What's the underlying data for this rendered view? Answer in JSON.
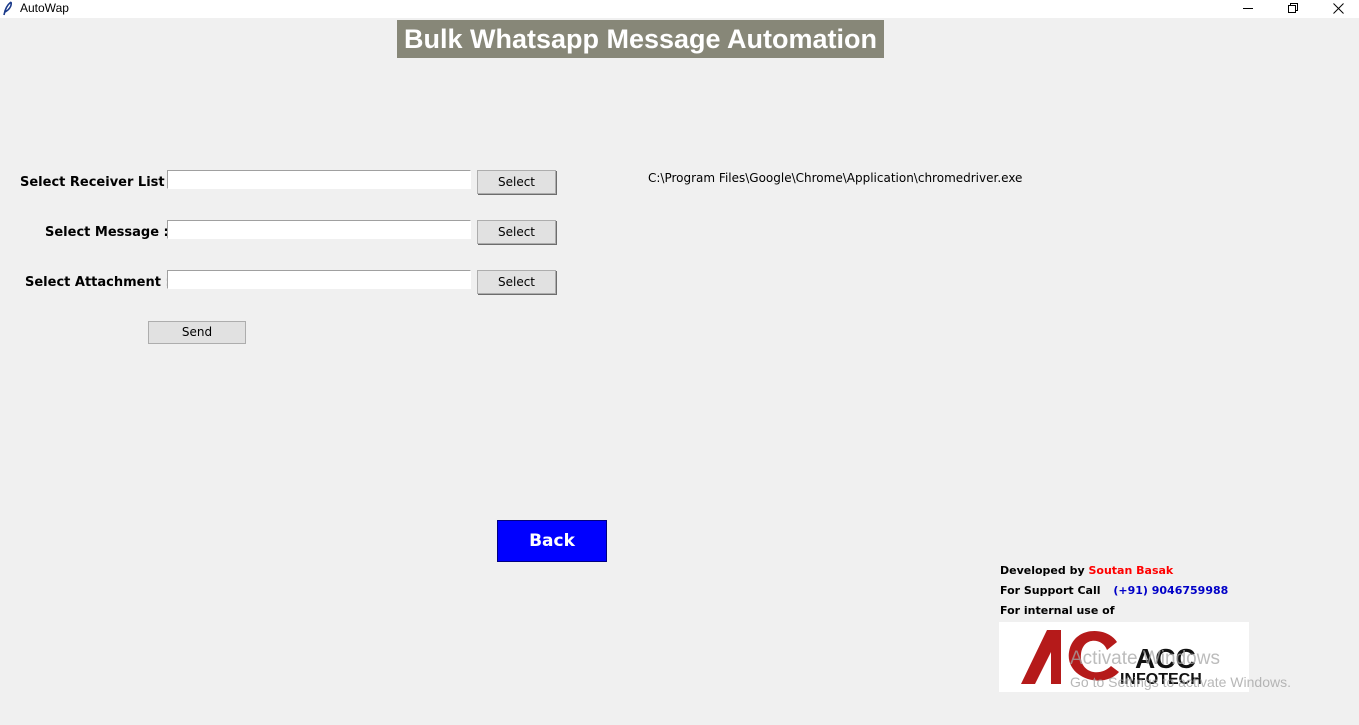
{
  "window": {
    "title": "AutoWap",
    "controls": {
      "minimize": "minimize-icon",
      "restore": "restore-icon",
      "close": "close-icon"
    }
  },
  "heading": "Bulk Whatsapp Message Automation",
  "form": {
    "receiver_label": "Select Receiver List :",
    "message_label": "Select Message :",
    "attachment_label": "Select Attachment :",
    "receiver_value": "",
    "message_value": "",
    "attachment_value": "",
    "select_label": "Select",
    "send_label": "Send"
  },
  "driver_path": "C:\\Program Files\\Google\\Chrome\\Application\\chromedriver.exe",
  "back_label": "Back",
  "footer": {
    "developed_by_label": "Developed by",
    "developer_name": "Soutan Basak",
    "support_label": "For Support Call",
    "support_phone": "(+91) 9046759988",
    "internal_label": "For internal use of",
    "logo_line1": "ACC",
    "logo_line2": "INFOTECH"
  },
  "watermark": {
    "line1": "Activate Windows",
    "line2": "Go to Settings to activate Windows."
  },
  "colors": {
    "heading_bg": "#878778",
    "back_bg": "#0000ff",
    "developer_name": "#ff0000",
    "support_phone": "#0000c8",
    "logo_red": "#b51a1a"
  }
}
